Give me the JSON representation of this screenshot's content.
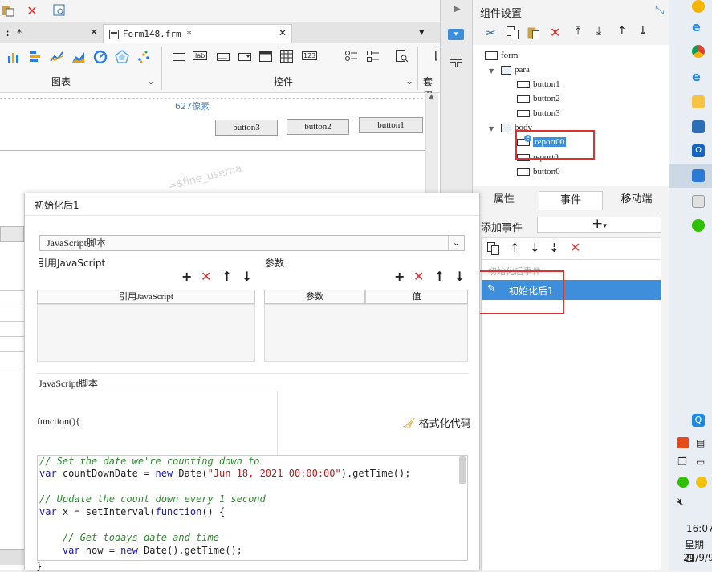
{
  "tabs": [
    {
      "label": ": *"
    },
    {
      "label": "Form148.frm *"
    }
  ],
  "ribbon": {
    "chart_group": "图表",
    "control_group": "控件",
    "cover_group": "套用"
  },
  "canvas": {
    "size_hint": "627像素",
    "buttons": [
      "button3",
      "button2",
      "button1"
    ],
    "watermark": "=$fine_userna"
  },
  "right_panel": {
    "title": "组件设置",
    "tree": {
      "form": "form",
      "para": "para",
      "button1": "button1",
      "button2": "button2",
      "button3": "button3",
      "body": "body",
      "report00": "report00",
      "report0": "report0",
      "button0": "button0"
    },
    "tabs": [
      "属性",
      "事件",
      "移动端"
    ],
    "add_event": "添加事件",
    "event_category": "初始化后事件",
    "event_item": "初始化后1"
  },
  "dialog": {
    "title": "初始化后1",
    "type_select": "JavaScript脚本",
    "ref_js_label": "引用JavaScript",
    "params_label": "参数",
    "ref_js_col": "引用JavaScript",
    "param_col": "参数",
    "value_col": "值",
    "script_label": "JavaScript脚本",
    "func_header": "function(){",
    "format_code": "格式化代码",
    "code": {
      "line1": "// Set the date we're counting down to",
      "line2_kw": "var",
      "line2_a": " countDownDate = ",
      "line2_new": "new",
      "line2_b": " Date(",
      "line2_str": "\"Jun 18, 2021 00:00:00\"",
      "line2_c": ").getTime();",
      "line3": "// Update the count down every 1 second",
      "line4_kw": "var",
      "line4_a": " x = setInterval(",
      "line4_fn": "function",
      "line4_b": "() {",
      "line5": "    // Get todays date and time",
      "line6_kw": "    var",
      "line6_a": " now = ",
      "line6_new": "new",
      "line6_b": " Date().getTime();"
    },
    "closing_brace": "}"
  },
  "taskbar": {
    "time": "16:07",
    "weekday": "星期四",
    "date": "21/9/9"
  },
  "colors": {
    "selection_blue": "#3d8fdc",
    "highlight_red": "#e0302f"
  }
}
